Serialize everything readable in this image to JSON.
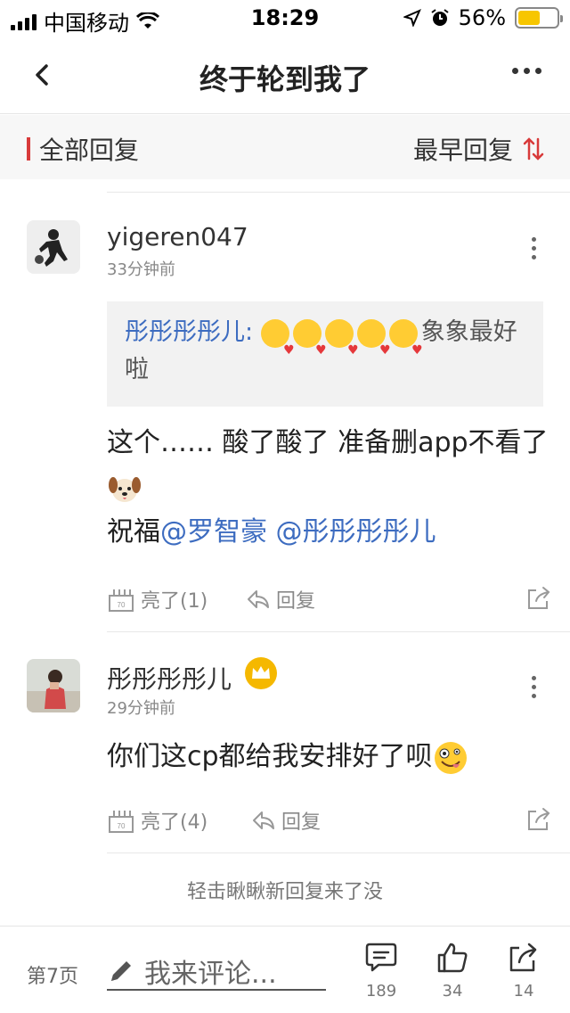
{
  "status_bar": {
    "carrier": "中国移动",
    "time": "18:29",
    "battery": "56%"
  },
  "nav": {
    "title": "终于轮到我了"
  },
  "filter": {
    "left_label": "全部回复",
    "right_label": "最早回复"
  },
  "comments": [
    {
      "user": "yigeren047",
      "time": "33分钟前",
      "quote_user": "彤彤彤彤儿:",
      "quote_tail": "象象最好啦",
      "text_part1": "这个…… 酸了酸了 准备删app不看了",
      "text_part2": "祝福",
      "mention1": "@罗智豪",
      "mention2": "@彤彤彤彤儿",
      "like_label": "亮了(1)",
      "reply_label": "回复"
    },
    {
      "user": "彤彤彤彤儿",
      "time": "29分钟前",
      "text": "你们这cp都给我安排好了呗",
      "like_label": "亮了(4)",
      "reply_label": "回复"
    }
  ],
  "load_more": "轻击瞅瞅新回复来了没",
  "bottom_bar": {
    "page": "第7页",
    "input_placeholder": "我来评论...",
    "comment_count": "189",
    "like_count": "34",
    "share_count": "14"
  },
  "colors": {
    "accent_red": "#d83a3a",
    "mention_blue": "#3d6cc0",
    "battery_yellow": "#f7c600",
    "crown_gold": "#f5b800"
  }
}
